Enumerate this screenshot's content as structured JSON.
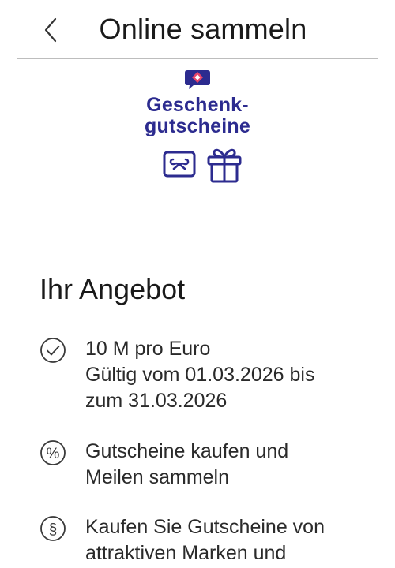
{
  "header": {
    "title": "Online sammeln",
    "back_icon": "chevron-left-icon"
  },
  "brand": {
    "line1": "Geschenk-",
    "line2": "gutscheine",
    "color": "#2c2b8f",
    "mark_color": "#2c2b8f",
    "mark_accent": "#e8456b",
    "icons": [
      "voucher-icon",
      "gift-icon"
    ]
  },
  "offer": {
    "title": "Ihr Angebot",
    "items": [
      {
        "icon": "check-circle-icon",
        "lines": [
          "10 M pro Euro",
          "Gültig vom 01.03.2026 bis",
          "zum 31.03.2026"
        ]
      },
      {
        "icon": "percent-circle-icon",
        "lines": [
          "Gutscheine kaufen und",
          "Meilen sammeln"
        ]
      },
      {
        "icon": "section-circle-icon",
        "lines": [
          "Kaufen Sie Gutscheine von",
          "attraktiven Marken und"
        ]
      }
    ]
  }
}
